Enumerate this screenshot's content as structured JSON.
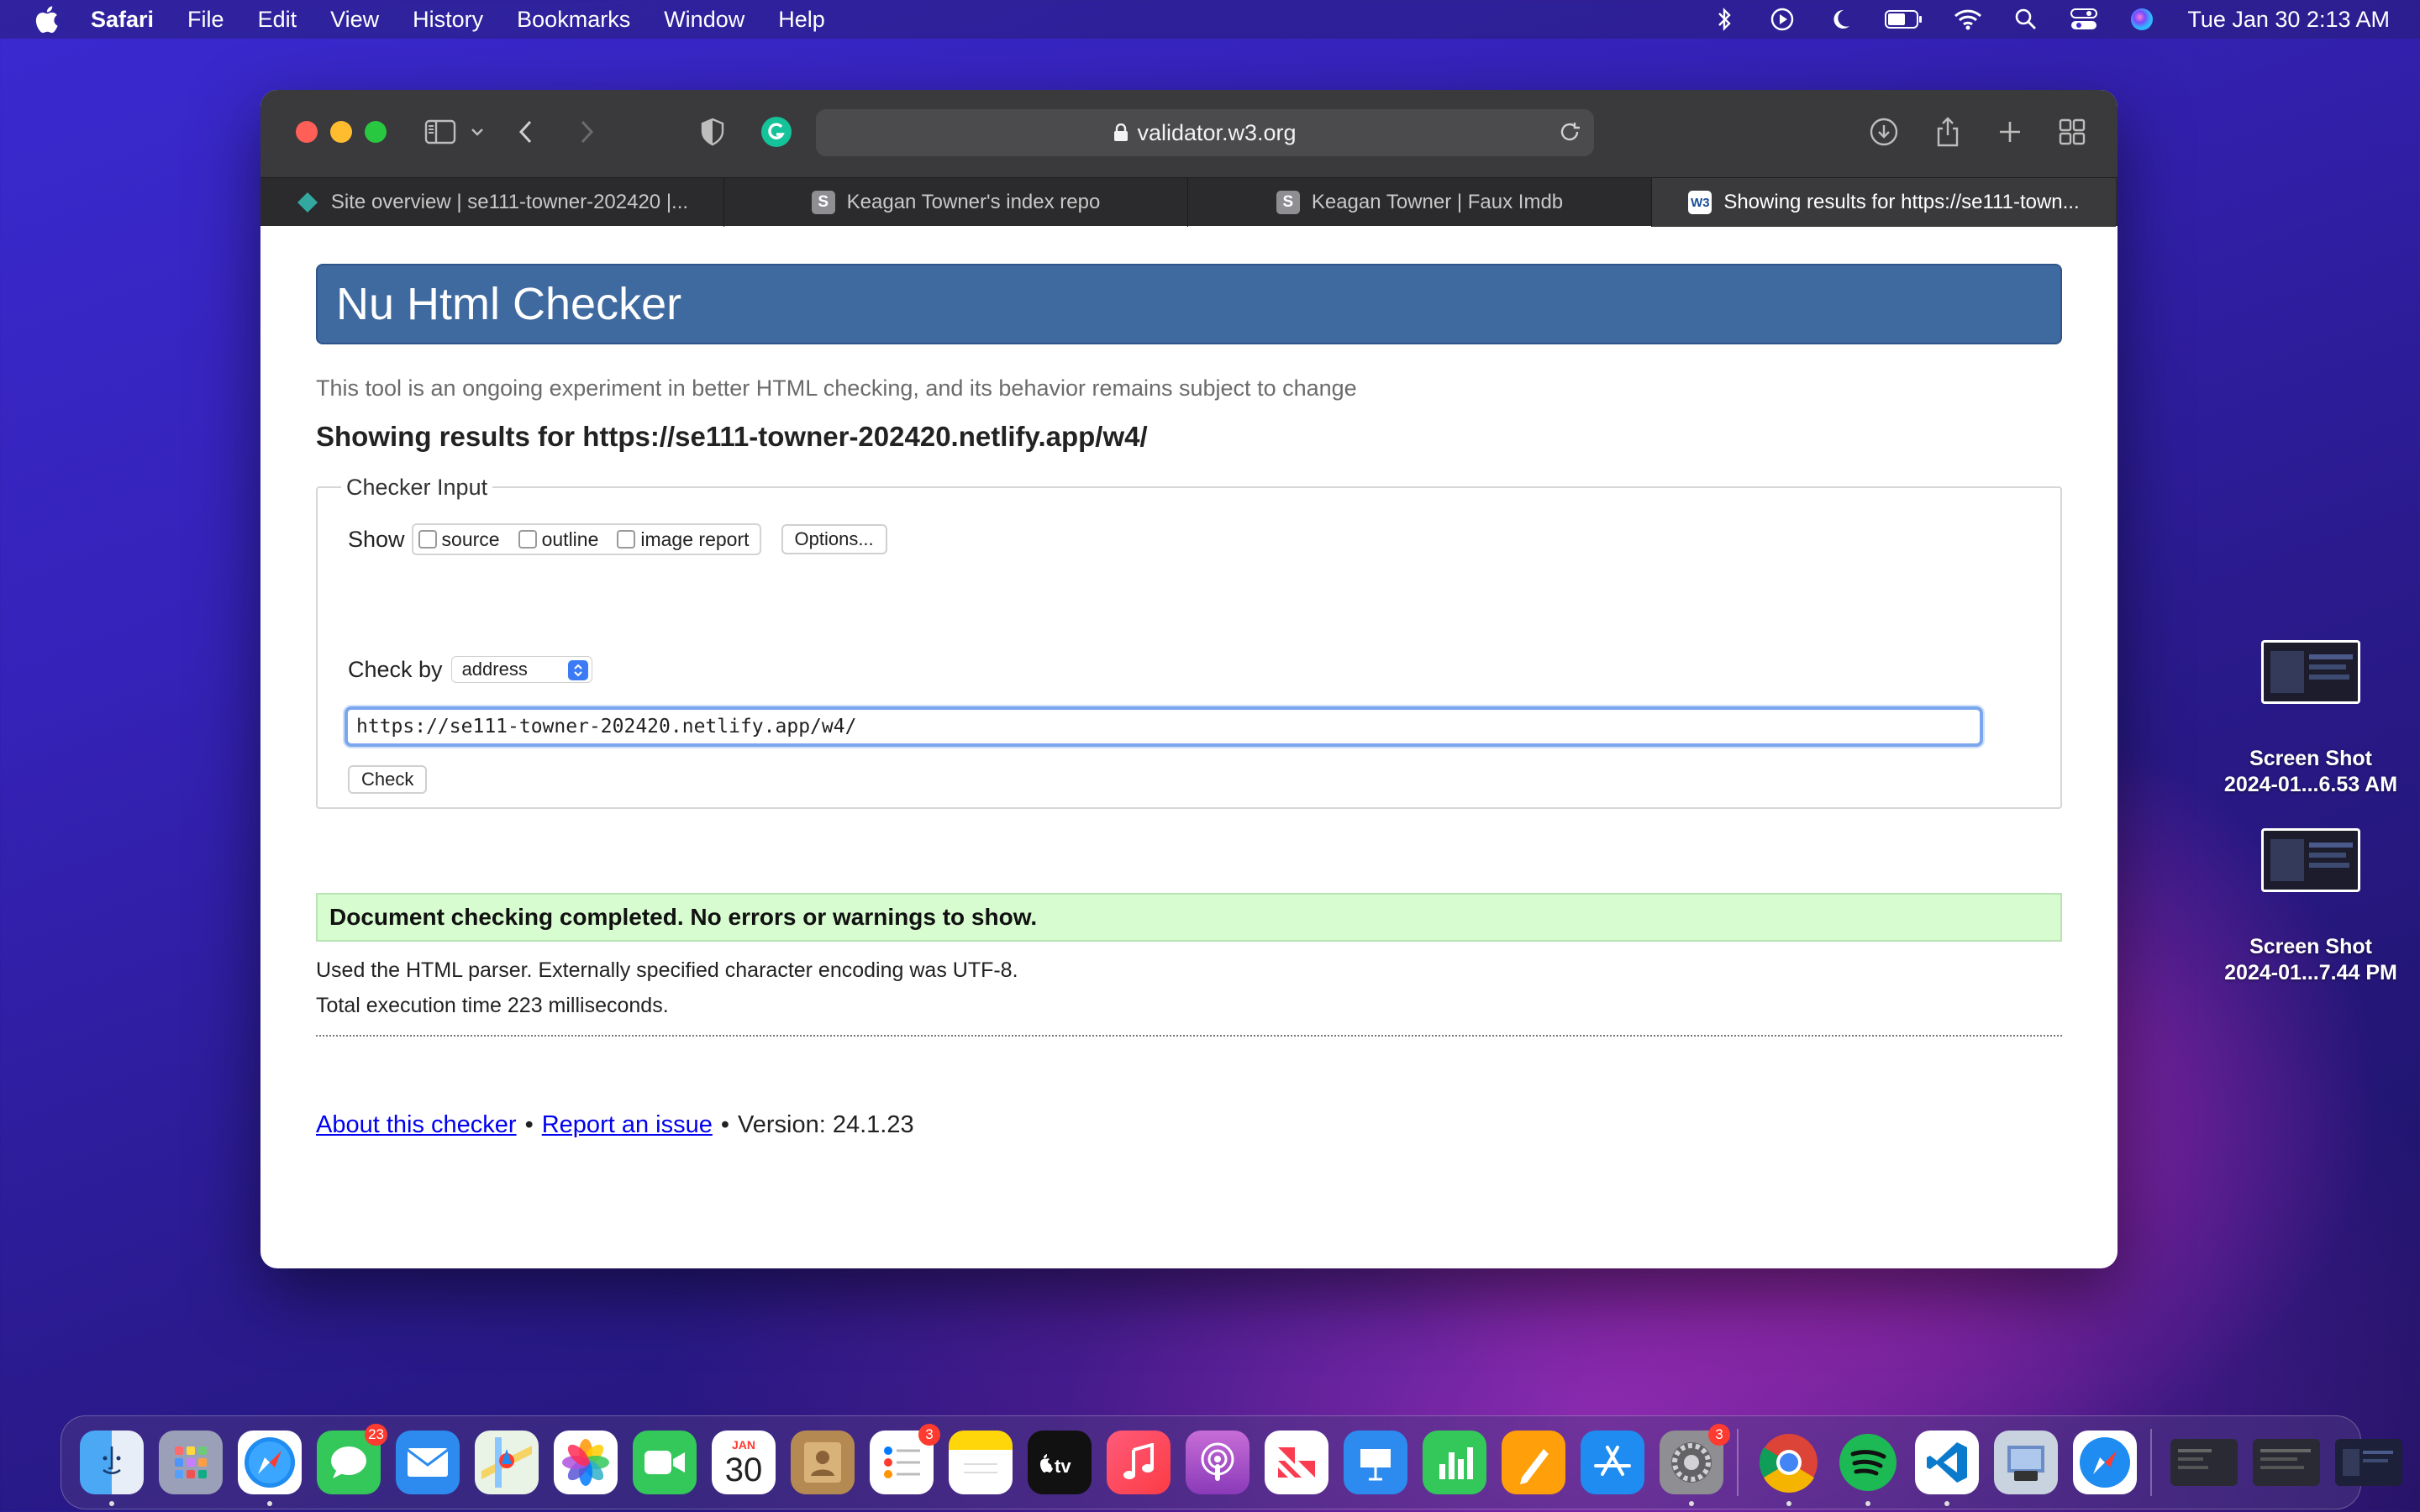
{
  "menubar": {
    "app_name": "Safari",
    "items": [
      "File",
      "Edit",
      "View",
      "History",
      "Bookmarks",
      "Window",
      "Help"
    ],
    "clock": "Tue Jan 30  2:13 AM"
  },
  "browser": {
    "address": "validator.w3.org",
    "tabs": [
      {
        "title": "Site overview | se111-towner-202420 |...",
        "favicon": "netlify-icon"
      },
      {
        "title": "Keagan Towner's index repo",
        "favicon": "S"
      },
      {
        "title": "Keagan Towner | Faux Imdb",
        "favicon": "S"
      },
      {
        "title": "Showing results for https://se111-town...",
        "favicon": "W3",
        "active": true
      }
    ]
  },
  "page": {
    "header": "Nu Html Checker",
    "intro": "This tool is an ongoing experiment in better HTML checking, and its behavior remains subject to change",
    "results_title": "Showing results for https://se111-towner-202420.netlify.app/w4/",
    "checker_input": {
      "legend": "Checker Input",
      "show_label": "Show",
      "show_options": [
        "source",
        "outline",
        "image report"
      ],
      "options_button": "Options...",
      "check_by_label": "Check by",
      "check_by_value": "address",
      "url_value": "https://se111-towner-202420.netlify.app/w4/",
      "check_button": "Check"
    },
    "success_message": "Document checking completed. No errors or warnings to show.",
    "parser_info": "Used the HTML parser. Externally specified character encoding was UTF-8.",
    "execution_time": "Total execution time 223 milliseconds.",
    "footer": {
      "about_link": "About this checker",
      "separator": "•",
      "report_link": "Report an issue",
      "version": "Version: 24.1.23"
    }
  },
  "desktop": {
    "icons": [
      {
        "line1": "Screen Shot",
        "line2": "2024-01...6.53 AM"
      },
      {
        "line1": "Screen Shot",
        "line2": "2024-01...7.44 PM"
      }
    ]
  },
  "dock": {
    "badges": {
      "messages": "23",
      "reminders": "3",
      "settings": "3"
    },
    "calendar_month": "JAN",
    "calendar_day": "30",
    "tv_label": "tv"
  }
}
